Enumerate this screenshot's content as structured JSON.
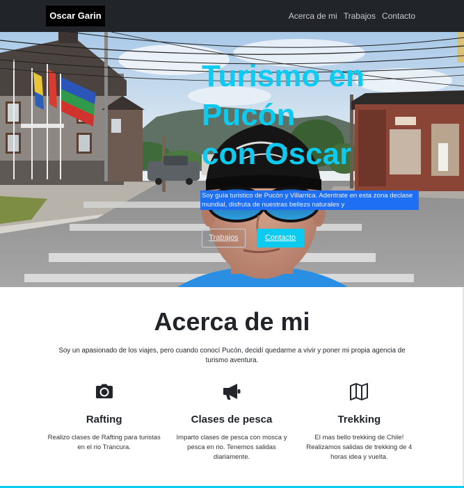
{
  "colors": {
    "accent": "#0dcaf0",
    "navbar_bg": "#212529",
    "brand_bg": "#000000",
    "hero_text_bg": "#1f6ff5",
    "text": "#212529"
  },
  "navbar": {
    "brand": "Oscar Garin",
    "links": [
      {
        "label": "Acerca de mi"
      },
      {
        "label": "Trabajos"
      },
      {
        "label": "Contacto"
      }
    ]
  },
  "hero": {
    "title_lines": [
      "Turismo en",
      "Pucón",
      "con Oscar"
    ],
    "text": "Soy guía turistico de Pucón y Villarrica. Adentrate en esta zona declase mundial, disfruta de nuestras bellezs naturales y",
    "buttons": [
      {
        "label": "Trabajos"
      },
      {
        "label": "Contacto"
      }
    ]
  },
  "about": {
    "heading": "Acerca de mi",
    "text": "Soy un apasionado de los viajes, pero cuando conocí Pucón, decidí quedarme a vivir y poner mi propia agencia de turismo aventura.",
    "features": [
      {
        "icon": "camera-icon",
        "title": "Rafting",
        "text": "Realizo clases de Rafting para turistas en el rio Trancura."
      },
      {
        "icon": "bullhorn-icon",
        "title": "Clases de pesca",
        "text": "Imparto clases de pesca con mosca y pesca en rio. Tenemos salidas diariamente."
      },
      {
        "icon": "map-icon",
        "title": "Trekking",
        "text": "El mas bello trekking de Chile! Realizamos salidas de trekking de 4 horas idea y vuelta."
      }
    ]
  }
}
